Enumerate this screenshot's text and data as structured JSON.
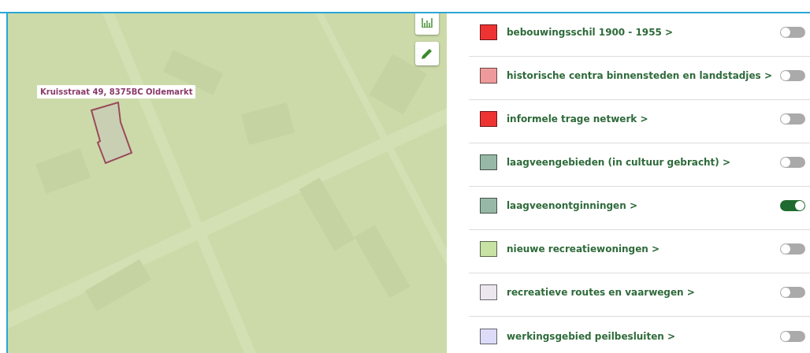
{
  "map": {
    "address_label": "Kruisstraat 49, 8375BC Oldemarkt"
  },
  "layers": [
    {
      "label": "bebouwingsschil 1900 - 1955 >",
      "color": "#ee3333",
      "on": false
    },
    {
      "label": "historische centra binnensteden en landstadjes >",
      "color": "#ee9a9a",
      "on": false
    },
    {
      "label": "informele trage netwerk >",
      "color": "#ee3333",
      "on": false
    },
    {
      "label": "laagveengebieden (in cultuur gebracht) >",
      "color": "#97b8a6",
      "on": false
    },
    {
      "label": "laagveenontginningen >",
      "color": "#97b8a6",
      "on": true
    },
    {
      "label": "nieuwe recreatiewoningen >",
      "color": "#c8e2a4",
      "on": false
    },
    {
      "label": "recreatieve routes en vaarwegen >",
      "color": "#ece6ee",
      "on": false
    },
    {
      "label": "werkingsgebied peilbesluiten >",
      "color": "#dcdcf8",
      "on": false
    }
  ]
}
